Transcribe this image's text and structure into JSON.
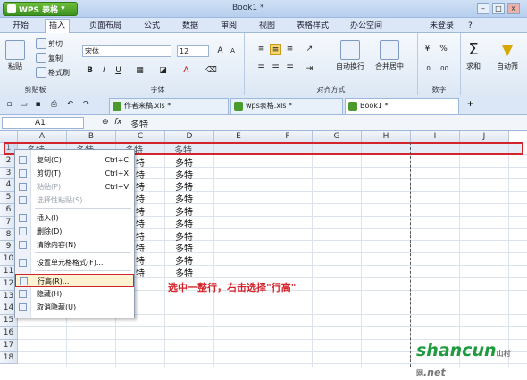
{
  "app": {
    "name": "WPS 表格",
    "doc_title": "Book1 *",
    "user": "未登录"
  },
  "menu_tabs": [
    "开始",
    "插入",
    "页面布局",
    "公式",
    "数据",
    "审阅",
    "视图",
    "表格样式",
    "办公空间"
  ],
  "ribbon": {
    "clipboard": {
      "paste": "粘贴",
      "cut": "剪切",
      "copy": "复制",
      "format_painter": "格式刷",
      "group": "剪贴板"
    },
    "font": {
      "name": "宋体",
      "size": "12",
      "group": "字体",
      "bold": "B",
      "italic": "I",
      "underline": "U"
    },
    "alignment": {
      "wrap": "自动换行",
      "merge": "合并居中",
      "group": "对齐方式"
    },
    "number": {
      "group": "数字",
      "percent": "%"
    },
    "editing": {
      "sum": "求和",
      "filter": "自动筛"
    }
  },
  "doc_tabs": [
    {
      "label": "作者来稿.xls *"
    },
    {
      "label": "wps表格.xls *"
    },
    {
      "label": "Book1 *"
    }
  ],
  "formula_bar": {
    "name_box": "A1",
    "fx": "fx",
    "value": "多特"
  },
  "columns": [
    "A",
    "B",
    "C",
    "D",
    "E",
    "F",
    "G",
    "H",
    "I",
    "J"
  ],
  "rows": [
    "1",
    "2",
    "3",
    "4",
    "5",
    "6",
    "7",
    "8",
    "9",
    "10",
    "11",
    "12",
    "13",
    "14",
    "15",
    "16",
    "17",
    "18"
  ],
  "row1_values": [
    "多特",
    "多特",
    "多特",
    "多特"
  ],
  "column_d_values": [
    "多特",
    "多特",
    "多特",
    "多特",
    "多特",
    "多特",
    "多特",
    "多特",
    "多特",
    "多特"
  ],
  "column_c_values": [
    "特",
    "特",
    "特",
    "特",
    "特",
    "特",
    "特",
    "特",
    "特",
    "特"
  ],
  "context_menu": [
    {
      "label": "复制(C)",
      "shortcut": "Ctrl+C",
      "disabled": false
    },
    {
      "label": "剪切(T)",
      "shortcut": "Ctrl+X",
      "disabled": false
    },
    {
      "label": "粘贴(P)",
      "shortcut": "Ctrl+V",
      "disabled": true
    },
    {
      "label": "选择性粘贴(S)...",
      "shortcut": "",
      "disabled": true
    },
    {
      "label": "插入(I)",
      "shortcut": "",
      "disabled": false
    },
    {
      "label": "删除(D)",
      "shortcut": "",
      "disabled": false
    },
    {
      "label": "清除内容(N)",
      "shortcut": "",
      "disabled": false
    },
    {
      "label": "设置单元格格式(F)...",
      "shortcut": "",
      "disabled": false
    },
    {
      "label": "行高(R)...",
      "shortcut": "",
      "disabled": false
    },
    {
      "label": "隐藏(H)",
      "shortcut": "",
      "disabled": false
    },
    {
      "label": "取消隐藏(U)",
      "shortcut": "",
      "disabled": false
    }
  ],
  "annotation": "选中一整行，右击选择\"行高\"",
  "watermark": {
    "brand": "shancun",
    "sub": "山村网",
    "domain": ".net"
  },
  "colors": {
    "accent_red": "#d4242b",
    "wps_green": "#4a9b2b",
    "ribbon_blue": "#dbe7f6"
  }
}
